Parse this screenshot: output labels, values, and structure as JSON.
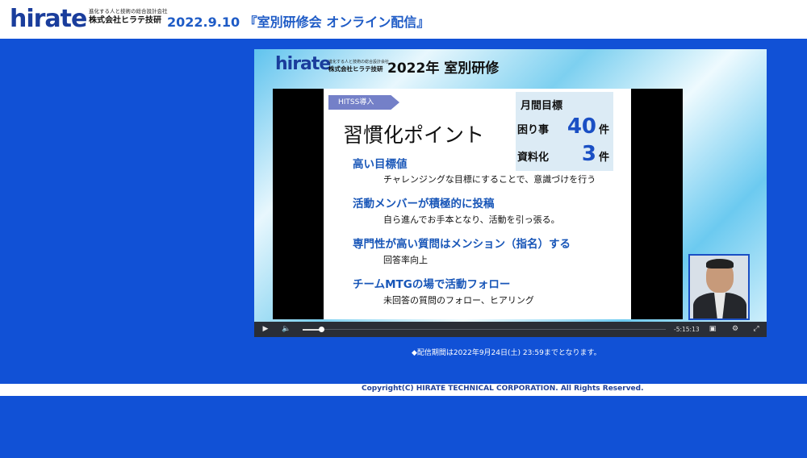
{
  "header": {
    "logo": "hirate",
    "tagline": "進化する人と技術の総合設計会社",
    "company": "株式会社ヒラテ技研",
    "title": "2022.9.10 『室別研修会 オンライン配信』"
  },
  "video": {
    "slide_header": {
      "logo": "hirate",
      "tagline": "進化する人と技術の総合設計会社",
      "company": "株式会社ヒラテ技研",
      "heading": "2022年 室別研修"
    },
    "slide": {
      "tag": "HITSS導入",
      "title": "習慣化ポイント",
      "goals": {
        "title": "月間目標",
        "rows": [
          {
            "label": "困り事",
            "value": "40",
            "unit": "件"
          },
          {
            "label": "資料化",
            "value": "3",
            "unit": "件"
          }
        ]
      },
      "points": [
        {
          "title": "高い目標値",
          "desc": "チャレンジングな目標にすることで、意識づけを行う"
        },
        {
          "title": "活動メンバーが積極的に投稿",
          "desc": "自ら進んでお手本となり、活動を引っ張る。"
        },
        {
          "title": "専門性が高い質問はメンション（指名）する",
          "desc": "回答率向上"
        },
        {
          "title": "チームMTGの場で活動フォロー",
          "desc": "未回答の質問のフォロー、ヒアリング"
        }
      ]
    },
    "controls": {
      "play_glyph": "▶",
      "volume_glyph": "🔈",
      "time": "-5:15:13",
      "pip_glyph": "▣",
      "settings_glyph": "⚙",
      "fullscreen_glyph": "⤢",
      "progress_fraction": 0.05
    }
  },
  "note": "◆配信期間は2022年9月24日(土) 23:59までとなります。",
  "footer": "Copyright(C) HIRATE TECHNICAL CORPORATION. All Rights Reserved.",
  "colors": {
    "background": "#1151d6",
    "brand": "#1a3d9c",
    "accent": "#1e5bc6"
  }
}
